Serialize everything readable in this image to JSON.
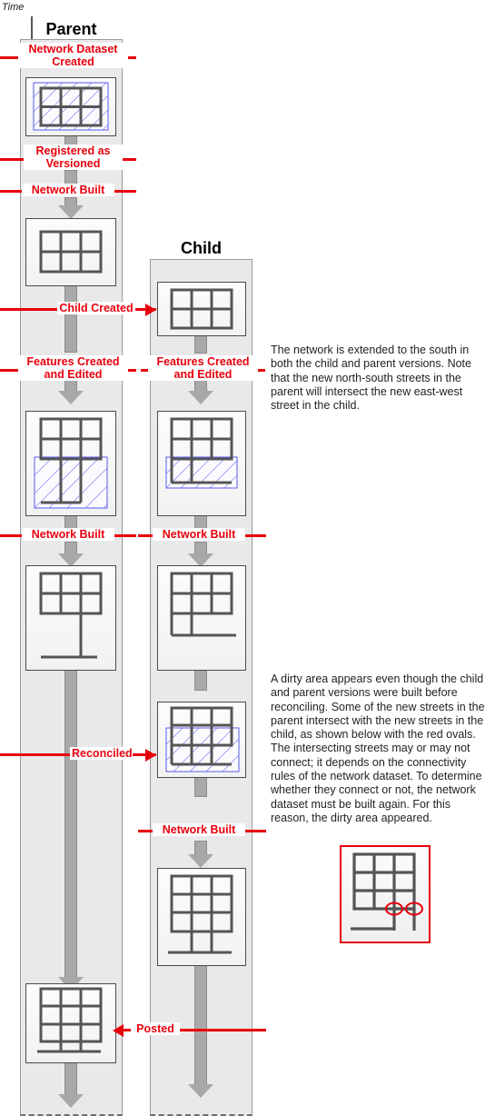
{
  "diagram": {
    "time_axis_label": "Time",
    "lanes": [
      {
        "id": "parent",
        "title": "Parent"
      },
      {
        "id": "child",
        "title": "Child"
      }
    ],
    "events": [
      {
        "id": "network-dataset-created",
        "label": "Network Dataset\nCreated",
        "lane": "parent"
      },
      {
        "id": "registered-as-versioned",
        "label": "Registered as\nVersioned",
        "lane": "parent"
      },
      {
        "id": "network-built-1",
        "label": "Network Built",
        "lane": "parent"
      },
      {
        "id": "child-created",
        "label": "Child Created",
        "lane": "parent-to-child",
        "arrow": "right"
      },
      {
        "id": "features-created-and-edited-parent",
        "label": "Features Created\nand Edited",
        "lane": "parent"
      },
      {
        "id": "features-created-and-edited-child",
        "label": "Features Created\nand Edited",
        "lane": "child"
      },
      {
        "id": "network-built-2-parent",
        "label": "Network Built",
        "lane": "parent"
      },
      {
        "id": "network-built-2-child",
        "label": "Network Built",
        "lane": "child"
      },
      {
        "id": "reconciled",
        "label": "Reconciled",
        "lane": "parent-to-child",
        "arrow": "right"
      },
      {
        "id": "network-built-3-child",
        "label": "Network Built",
        "lane": "child"
      },
      {
        "id": "posted",
        "label": "Posted",
        "lane": "child-to-parent",
        "arrow": "left"
      }
    ],
    "notes": [
      {
        "id": "note-extension",
        "text": "The network is extended to the south in both the child and parent versions. Note that the new north-south streets in the parent will intersect the new east-west street in the child."
      },
      {
        "id": "note-dirty-area",
        "text": "A dirty area appears even though the child and parent versions were built before reconciling. Some of the new streets in the parent intersect with the new streets in the child, as shown below with the red ovals. The intersecting streets may or may not connect; it depends on the connectivity rules of the network dataset. To determine whether they connect or not, the network dataset must be built again. For this reason, the dirty area appeared."
      }
    ],
    "colors": {
      "event_red": "#e8000d",
      "dirty_area_blue": "#5a5aec",
      "street_grey": "#555555",
      "lane_fill": "#e9e9e9",
      "flow_arrow": "#a8a8a8"
    },
    "callout": {
      "id": "dirty-area-detail",
      "marker_count": 2,
      "marker_shape": "oval",
      "marker_color": "#e8000d"
    }
  }
}
